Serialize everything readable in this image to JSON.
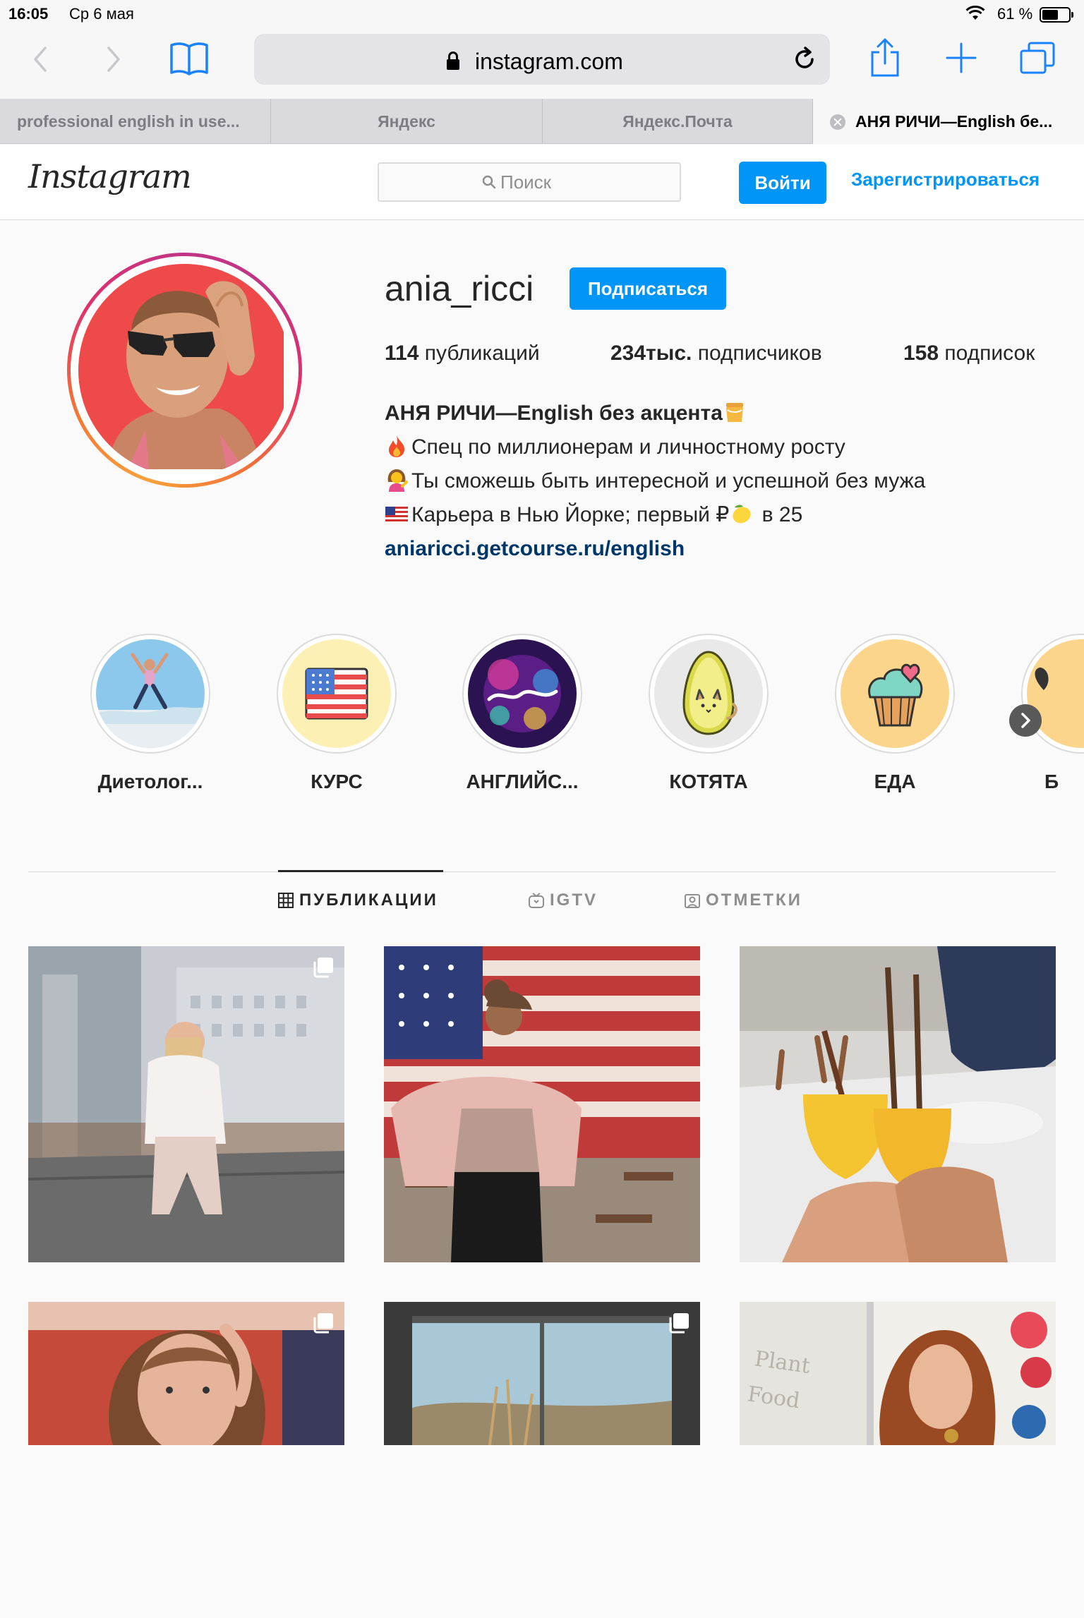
{
  "status_bar": {
    "time": "16:05",
    "date": "Ср 6 мая",
    "battery_pct": "61 %",
    "battery_level": 0.61
  },
  "browser": {
    "url": "instagram.com",
    "tabs": [
      {
        "title": "professional english in use..."
      },
      {
        "title": "Яндекс"
      },
      {
        "title": "Яндекс.Почта"
      },
      {
        "title": "АНЯ РИЧИ—English бе..."
      }
    ]
  },
  "ig_header": {
    "logo": "Instagram",
    "search_placeholder": "Поиск",
    "login_label": "Войти",
    "signup_label": "Зарегистрироваться"
  },
  "profile": {
    "username": "ania_ricci",
    "follow_label": "Подписаться",
    "posts_count": "114",
    "posts_label": " публикаций",
    "followers_count": "234тыс.",
    "followers_label": " подписчиков",
    "following_count": "158",
    "following_label": " подписок",
    "bio_name": "АНЯ РИЧИ—English без акцента",
    "bio_line1": "Спец по миллионерам и личностному росту",
    "bio_line2": "Ты сможешь быть интересной и успешной без мужа",
    "bio_line3a": "Карьера в Нью Йорке; первый ₽",
    "bio_line3b": " в 25",
    "link": "aniaricci.getcourse.ru/english"
  },
  "highlights": [
    {
      "label": "Диетолог..."
    },
    {
      "label": "КУРС"
    },
    {
      "label": "АНГЛИЙС..."
    },
    {
      "label": "КОТЯТА"
    },
    {
      "label": "ЕДА"
    },
    {
      "label": "Б"
    }
  ],
  "profile_tabs": [
    {
      "label": "ПУБЛИКАЦИИ",
      "active": true
    },
    {
      "label": "IGTV",
      "active": false
    },
    {
      "label": "ОТМЕТКИ",
      "active": false
    }
  ],
  "colors": {
    "accent": "#0095f6",
    "safari_blue": "#1a82fb",
    "link": "#00376b"
  }
}
